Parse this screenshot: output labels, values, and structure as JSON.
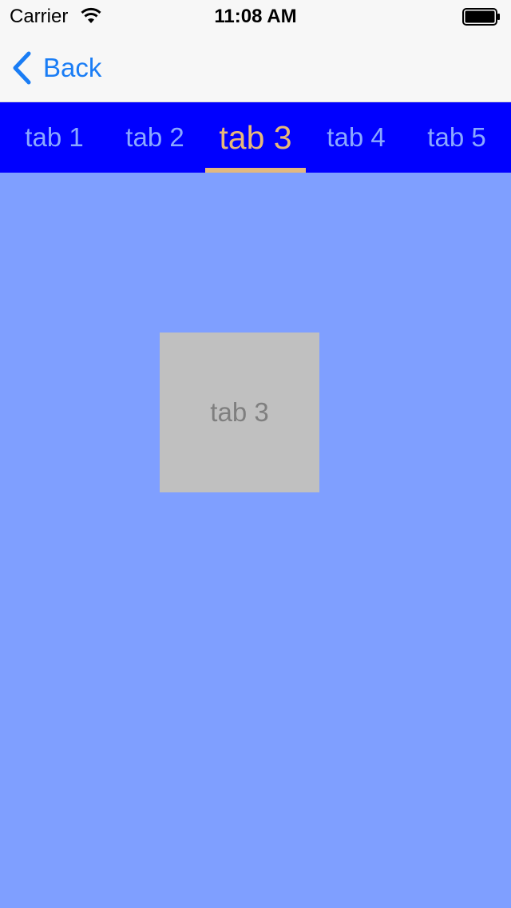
{
  "status_bar": {
    "carrier": "Carrier",
    "time": "11:08 AM",
    "wifi_icon": "wifi-icon",
    "battery_icon": "battery-icon",
    "battery_level": 1.0
  },
  "nav_bar": {
    "back_label": "Back",
    "back_icon": "chevron-left-icon",
    "tint_color": "#1a7df5"
  },
  "tabs": {
    "items": [
      {
        "label": "tab 1"
      },
      {
        "label": "tab 2"
      },
      {
        "label": "tab 3"
      },
      {
        "label": "tab 4"
      },
      {
        "label": "tab 5"
      }
    ],
    "selected_index": 2,
    "strip_color": "#0000ff",
    "unselected_color": "#8aa8ff",
    "selected_color": "#e6b87a",
    "indicator_color": "#e2b880"
  },
  "content": {
    "background_color": "#7f9fff",
    "card_label": "tab 3",
    "card_color": "#c0c0c0"
  }
}
